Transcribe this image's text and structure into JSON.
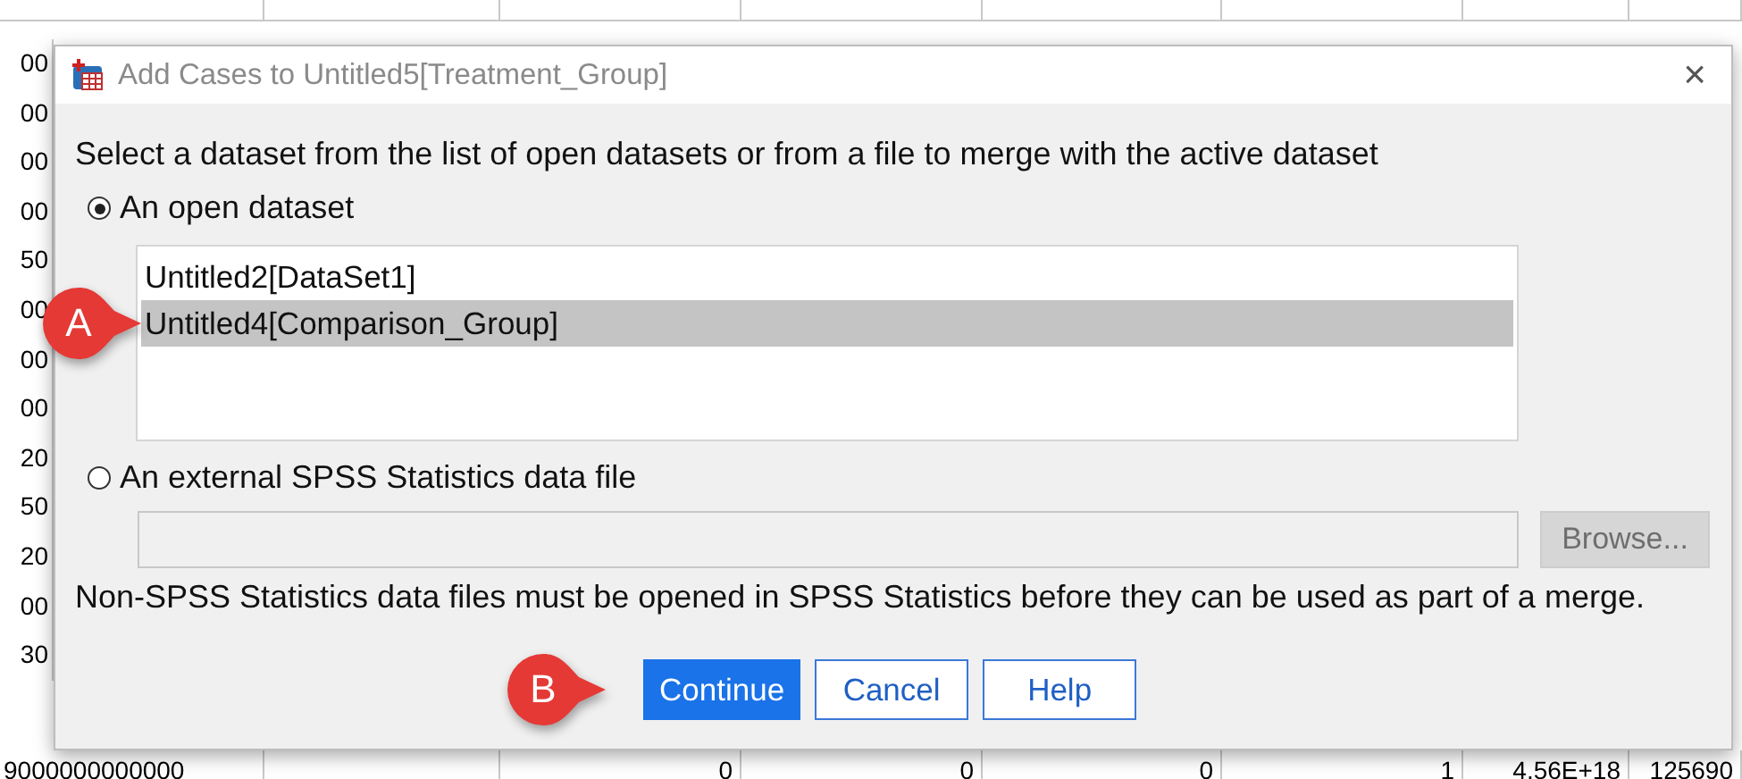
{
  "sheet": {
    "left_cells": [
      "00",
      "00",
      "00",
      "00",
      "50",
      "00",
      "00",
      "00",
      "20",
      "50",
      "20",
      "00",
      "30"
    ],
    "bottom_row": {
      "first": "9000000000000",
      "cells": [
        "0",
        "0",
        "0",
        "1",
        "4.56E+18",
        "125690"
      ]
    }
  },
  "dialog": {
    "title": "Add Cases to Untitled5[Treatment_Group]",
    "close": "×",
    "instruction": "Select a dataset from the list of open datasets or from a file to merge with the active dataset",
    "options": [
      {
        "label": "An open dataset",
        "selected": true
      },
      {
        "label": "An external SPSS Statistics data file",
        "selected": false
      }
    ],
    "datasets": [
      {
        "name": "Untitled2[DataSet1]",
        "selected": false
      },
      {
        "name": "Untitled4[Comparison_Group]",
        "selected": true
      }
    ],
    "browse": {
      "label": "Browse...",
      "disabled": true
    },
    "note": "Non-SPSS Statistics data files must be opened in SPSS Statistics before they can be used as part of a merge.",
    "buttons": [
      {
        "label": "Continue",
        "default": true
      },
      {
        "label": "Cancel",
        "default": false
      },
      {
        "label": "Help",
        "default": false
      }
    ]
  },
  "callouts": [
    {
      "label": "A"
    },
    {
      "label": "B"
    }
  ]
}
